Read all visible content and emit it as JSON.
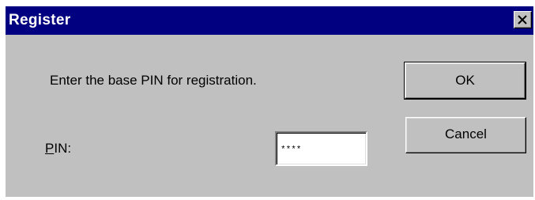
{
  "window": {
    "title": "Register",
    "titlebar_color": "#000080",
    "background_color": "#c0c0c0",
    "close_icon": "close-icon"
  },
  "dialog": {
    "prompt": "Enter the base PIN for registration.",
    "pin_label_mnemonic": "P",
    "pin_label_rest": "IN:",
    "pin_value": "****"
  },
  "buttons": {
    "ok_label": "OK",
    "cancel_label": "Cancel"
  }
}
